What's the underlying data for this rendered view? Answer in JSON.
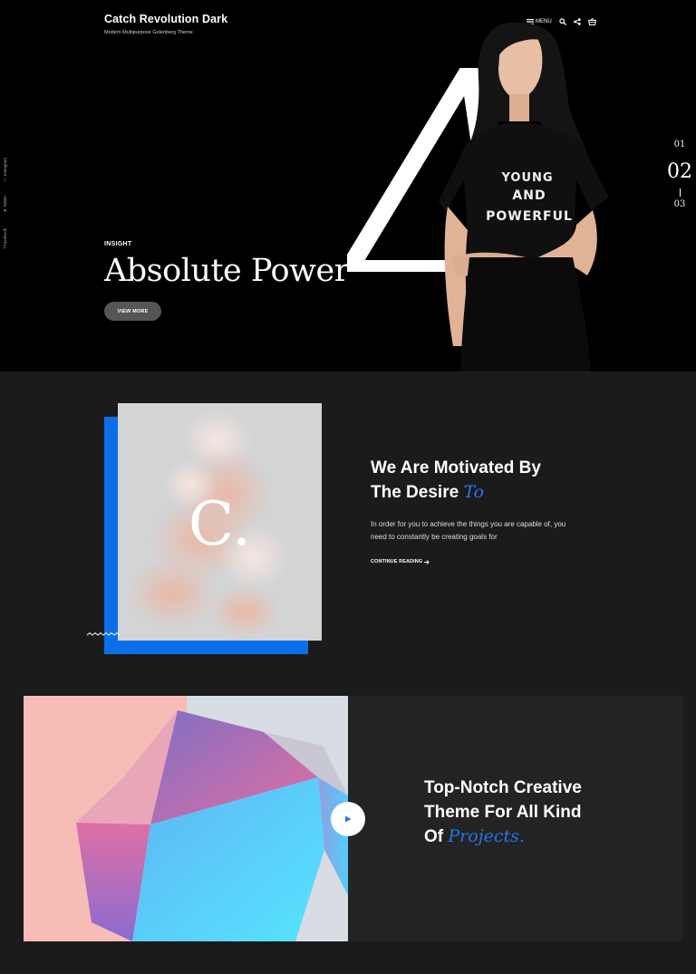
{
  "header": {
    "site_title": "Catch Revolution Dark",
    "tagline": "Modern Multipurpose Gutenberg Theme",
    "menu_label": "MENU"
  },
  "social": [
    {
      "label": "Instagram",
      "icon": "instagram-icon"
    },
    {
      "label": "twitter",
      "icon": "twitter-icon"
    },
    {
      "label": "Facebook",
      "icon": "facebook-icon"
    }
  ],
  "hero": {
    "kicker": "INSIGHT",
    "title": "Absolute Power",
    "button_label": "VIEW MORE",
    "shirt_lines": [
      "YOUNG",
      "AND",
      "POWERFUL"
    ]
  },
  "slider": {
    "prev": "01",
    "current": "02",
    "next": "03"
  },
  "intro": {
    "image_letter": "C.",
    "heading_line1": "We Are Motivated By",
    "heading_line2": "The Desire",
    "heading_accent": "To",
    "text": "In order for you to achieve the things you are capable of, you need to constantly be creating goals for",
    "link_label": "CONTINUE READING"
  },
  "feature": {
    "heading_line1": "Top-Notch Creative",
    "heading_line2": "Theme For All Kind",
    "heading_line3": "Of",
    "heading_accent": "Projects."
  },
  "colors": {
    "accent": "#1f79ea",
    "hero_bg": "#000000",
    "page_bg": "#1b1b1c",
    "card_bg": "#232324"
  }
}
